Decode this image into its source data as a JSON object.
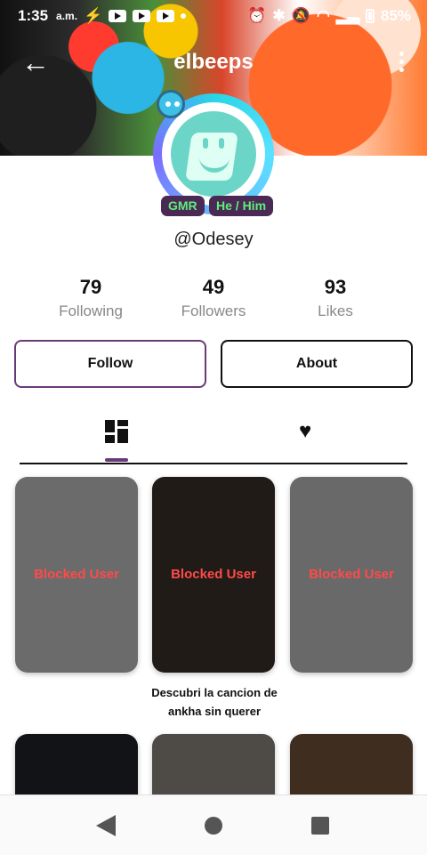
{
  "status_bar": {
    "time": "1:35",
    "ampm": "a.m.",
    "battery": "85%"
  },
  "header": {
    "title": "elbeeps"
  },
  "profile": {
    "handle": "@Odesey",
    "tags": [
      "GMR",
      "He / Him"
    ]
  },
  "stats": [
    {
      "value": "79",
      "label": "Following"
    },
    {
      "value": "49",
      "label": "Followers"
    },
    {
      "value": "93",
      "label": "Likes"
    }
  ],
  "buttons": {
    "follow": "Follow",
    "about": "About"
  },
  "tabs": [
    {
      "icon": "grid-icon",
      "active": true
    },
    {
      "icon": "heart-icon",
      "active": false
    }
  ],
  "posts": [
    {
      "label": "Blocked User",
      "bg": "#6b6b6b"
    },
    {
      "label": "Blocked User",
      "bg": "#211b18"
    },
    {
      "label": "Blocked User",
      "bg": "#696969"
    },
    {
      "label": "",
      "bg": "#121316"
    },
    {
      "label": "",
      "bg": "#4e4b46"
    },
    {
      "label": "",
      "bg": "#3f2e20"
    }
  ],
  "caption": "Descubri la cancion de ankha sin querer",
  "colors": {
    "accent": "#6a3a78",
    "tag_bg": "#4b2955",
    "tag_text": "#5cf07a",
    "blocked_text": "#ff4a4a"
  }
}
